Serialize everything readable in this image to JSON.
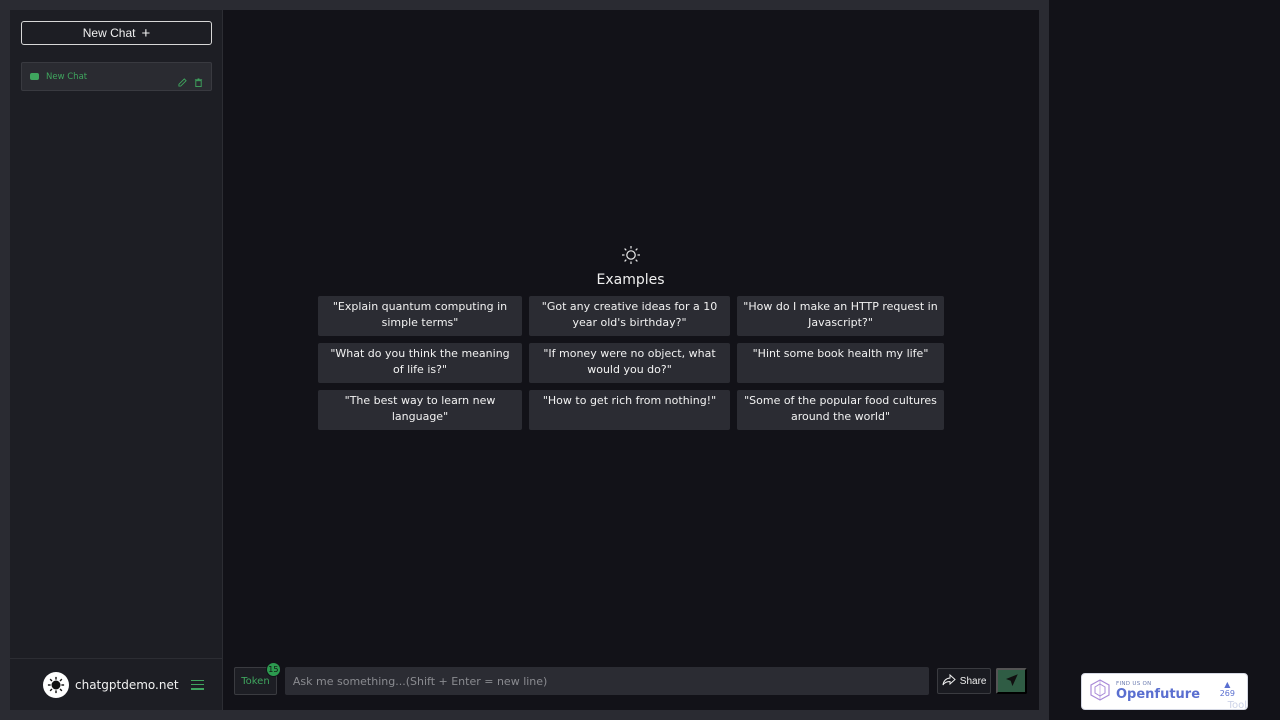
{
  "sidebar": {
    "new_chat_label": "New Chat",
    "chat_items": [
      {
        "label": "New Chat"
      }
    ],
    "footer": {
      "site_name": "chatgptdemo.net"
    }
  },
  "main": {
    "examples_title": "Examples",
    "examples": [
      "\"Explain quantum computing in simple terms\"",
      "\"Got any creative ideas for a 10 year old's birthday?\"",
      "\"How do I make an HTTP request in Javascript?\"",
      "\"What do you think the meaning of life is?\"",
      "\"If money were no object, what would you do?\"",
      "\"Hint some book health my life\"",
      "\"The best way to learn new language\"",
      "\"How to get rich from nothing!\"",
      "\"Some of the popular food cultures around the world\""
    ]
  },
  "input_bar": {
    "token_label": "Token",
    "token_count": "15",
    "placeholder": "Ask me something...(Shift + Enter = new line)",
    "share_label": "Share"
  },
  "openfuture_badge": {
    "small_text": "FIND US ON",
    "brand": "Openfuture",
    "votes": "269",
    "overlay_text": "Tool"
  },
  "colors": {
    "accent_green": "#3fa55e",
    "background": "#121218",
    "sidebar": "#1d1e24",
    "card": "#2b2c33"
  }
}
